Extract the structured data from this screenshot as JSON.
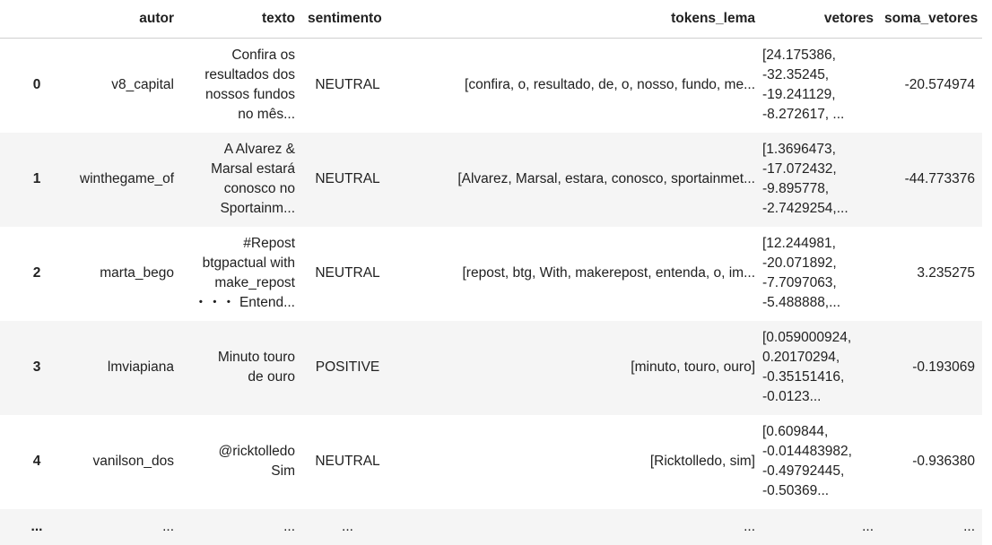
{
  "columns": {
    "index": "",
    "autor": "autor",
    "texto": "texto",
    "sentimento": "sentimento",
    "tokens_lema": "tokens_lema",
    "vetores": "vetores",
    "soma_vetores": "soma_vetores"
  },
  "rows": [
    {
      "index": "0",
      "autor": "v8_capital",
      "texto": "Confira os\nresultados dos\nnossos fundos\nno mês...",
      "sentimento": "NEUTRAL",
      "tokens_lema": "[confira, o, resultado, de, o, nosso, fundo, me...",
      "vetores": "[24.175386,\n-32.35245,\n-19.241129,\n-8.272617, ...",
      "soma_vetores": "-20.574974"
    },
    {
      "index": "1",
      "autor": "winthegame_of",
      "texto": "A Alvarez &\nMarsal estará\nconosco no\nSportainm...",
      "sentimento": "NEUTRAL",
      "tokens_lema": "[Alvarez, Marsal, estara, conosco, sportainmet...",
      "vetores": "[1.3696473,\n-17.072432,\n-9.895778,\n-2.7429254,...",
      "soma_vetores": "-44.773376"
    },
    {
      "index": "2",
      "autor": "marta_bego",
      "texto": "#Repost\nbtgpactual with\nmake_repost\n・・・ Entend...",
      "sentimento": "NEUTRAL",
      "tokens_lema": "[repost, btg, With, makerepost, entenda, o, im...",
      "vetores": "[12.244981,\n-20.071892,\n-7.7097063,\n-5.488888,...",
      "soma_vetores": "3.235275"
    },
    {
      "index": "3",
      "autor": "lmviapiana",
      "texto": "Minuto touro\nde ouro",
      "sentimento": "POSITIVE",
      "tokens_lema": "[minuto, touro, ouro]",
      "vetores": "[0.059000924,\n0.20170294,\n-0.35151416,\n-0.0123...",
      "soma_vetores": "-0.193069"
    },
    {
      "index": "4",
      "autor": "vanilson_dos",
      "texto": "@ricktolledo\nSim",
      "sentimento": "NEUTRAL",
      "tokens_lema": "[Ricktolledo, sim]",
      "vetores": "[0.609844,\n-0.014483982,\n-0.49792445,\n-0.50369...",
      "soma_vetores": "-0.936380"
    }
  ],
  "ellipsis": "..."
}
